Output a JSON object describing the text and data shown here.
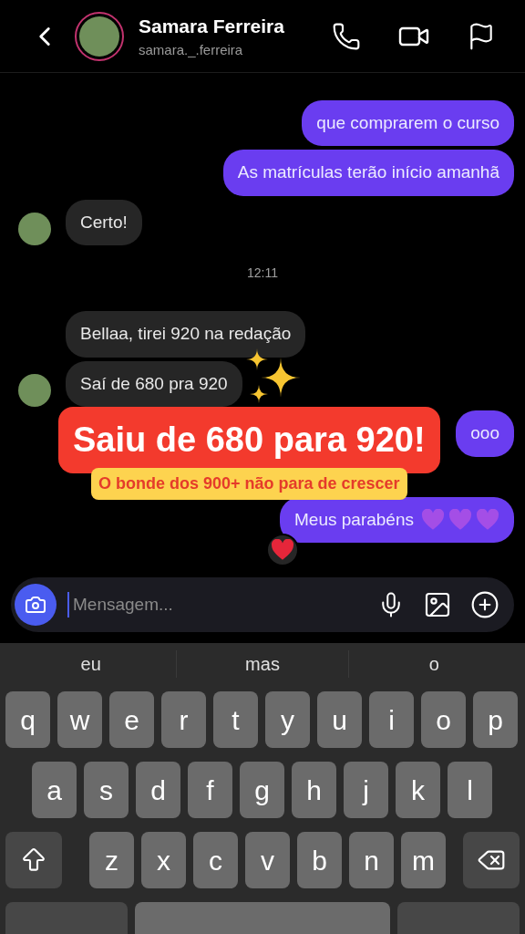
{
  "header": {
    "name": "Samara Ferreira",
    "username": "samara._.ferreira"
  },
  "messages": [
    {
      "kind": "sent",
      "text": "que comprarem o curso"
    },
    {
      "kind": "sent",
      "text": "As matrículas terão início amanhã"
    },
    {
      "kind": "received",
      "text": "Certo!",
      "avatar": true
    },
    {
      "kind": "time",
      "text": "12:11"
    },
    {
      "kind": "received",
      "text": "Bellaa, tirei 920 na redação",
      "avatar": false
    },
    {
      "kind": "received",
      "text": "Saí de 680 pra 920",
      "avatar": true,
      "sparkles": true
    },
    {
      "kind": "sent",
      "text": "ooo"
    },
    {
      "kind": "sent",
      "text": "Meus parabéns",
      "hearts": true,
      "reaction": true
    }
  ],
  "overlay": {
    "title": "Saiu de 680 para 920!",
    "subtitle": "O bonde dos 900+ não para de crescer"
  },
  "composer": {
    "placeholder": "Mensagem..."
  },
  "keyboard": {
    "suggestions": [
      "eu",
      "mas",
      "o"
    ],
    "rows": [
      [
        "q",
        "w",
        "e",
        "r",
        "t",
        "y",
        "u",
        "i",
        "o",
        "p"
      ],
      [
        "a",
        "s",
        "d",
        "f",
        "g",
        "h",
        "j",
        "k",
        "l"
      ],
      [
        "z",
        "x",
        "c",
        "v",
        "b",
        "n",
        "m"
      ]
    ]
  }
}
